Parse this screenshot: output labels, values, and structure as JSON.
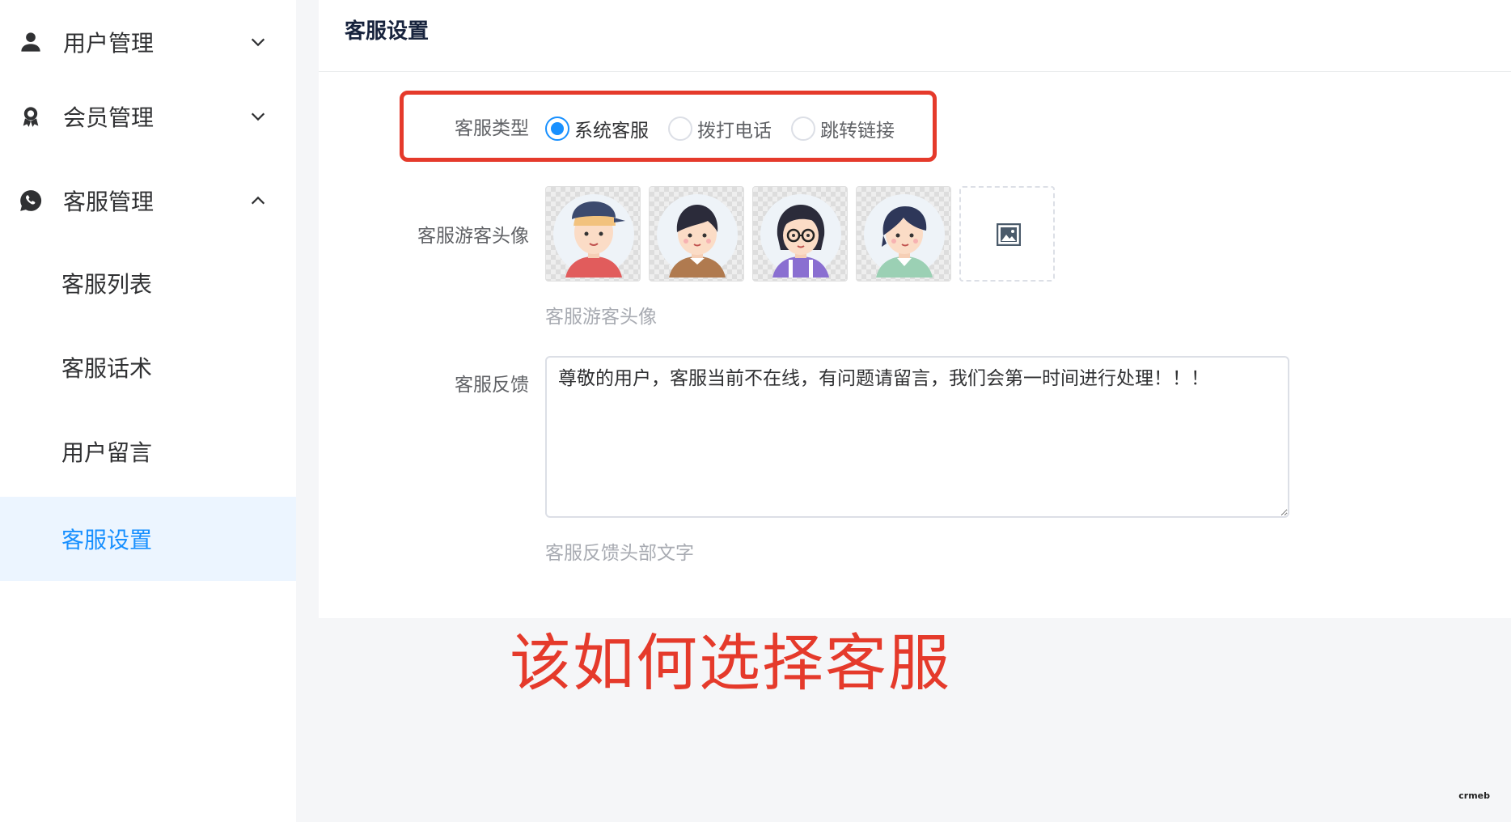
{
  "sidebar": {
    "groups": [
      {
        "label": "用户管理",
        "icon": "user-icon",
        "expanded": false
      },
      {
        "label": "会员管理",
        "icon": "award-icon",
        "expanded": false
      },
      {
        "label": "客服管理",
        "icon": "chat-phone-icon",
        "expanded": true
      }
    ],
    "sub_items": [
      {
        "label": "客服列表",
        "active": false
      },
      {
        "label": "客服话术",
        "active": false
      },
      {
        "label": "用户留言",
        "active": false
      },
      {
        "label": "客服设置",
        "active": true
      }
    ]
  },
  "panel": {
    "title": "客服设置",
    "service_type": {
      "label": "客服类型",
      "options": [
        "系统客服",
        "拨打电话",
        "跳转链接"
      ],
      "selected": "系统客服"
    },
    "avatar": {
      "label": "客服游客头像",
      "hint": "客服游客头像",
      "count": 4,
      "upload_icon": "image-upload-icon"
    },
    "feedback": {
      "label": "客服反馈",
      "value": "尊敬的用户，客服当前不在线，有问题请留言，我们会第一时间进行处理！！！",
      "hint": "客服反馈头部文字"
    }
  },
  "annotation": "该如何选择客服",
  "logo_text": "crmeb",
  "colors": {
    "accent": "#1890ff",
    "active_bg": "#ecf5ff",
    "annotation_red": "#e53a2b",
    "page_bg": "#f5f6f8"
  }
}
